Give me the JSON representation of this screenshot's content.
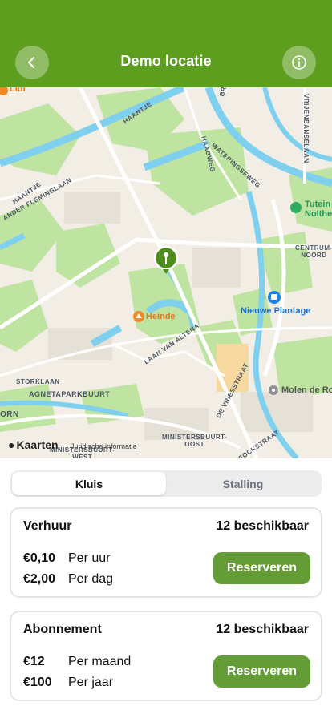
{
  "header": {
    "title": "Demo locatie",
    "back_icon": "chevron-left-icon",
    "info_icon": "info-icon",
    "color": "#5e9e1f"
  },
  "map": {
    "street_labels": {
      "brassersplein": "BRASSERSPLEIN",
      "haagweg": "HAAGWEG",
      "vrijenbanselaan": "VRIJENBANSELAAN",
      "wateringseweg": "WATERINGSEWEG",
      "haantje1": "HAANTJE",
      "haantje2": "HAANTJE",
      "fleminglaan": "ANDER FLEMINGLAAN",
      "centrum_noord": "CENTRUM-\nNOORD",
      "laan_van_altena": "LAAN VAN ALTENA",
      "storklaan": "STORKLAAN",
      "agnetapark": "AGNETAPARKBUURT",
      "orn": "ORN",
      "ministersbuurt_west": "MINISTERSBUURT-\nWEST",
      "ministersbuurt_oost": "MINISTERSBUURT-\nOOST",
      "de_vriesstraat": "DE VRIESSTRAAT",
      "fockstraat": "FOCKSTRAAT"
    },
    "pois": {
      "lidl": "Lidl",
      "heinde": "Heinde",
      "tutein_1": "Tutein",
      "tutein_2": "Nolthe",
      "nieuwe_plantage": "Nieuwe Plantage",
      "molen": "Molen de Ro"
    },
    "logo_text": "Kaarten",
    "legal_text": "Juridische informatie",
    "marker_color": "#4f8c1e"
  },
  "tabs": {
    "items": [
      "Kluis",
      "Stalling"
    ],
    "active": "Kluis"
  },
  "cards": [
    {
      "title": "Verhuur",
      "availability": "12 beschikbaar",
      "prices": [
        {
          "amount": "€0,10",
          "unit": "Per uur"
        },
        {
          "amount": "€2,00",
          "unit": "Per dag"
        }
      ],
      "button": "Reserveren"
    },
    {
      "title": "Abonnement",
      "availability": "12 beschikbaar",
      "prices": [
        {
          "amount": "€12",
          "unit": "Per maand"
        },
        {
          "amount": "€100",
          "unit": "Per jaar"
        }
      ],
      "button": "Reserveren"
    }
  ],
  "accent": "#649c35"
}
